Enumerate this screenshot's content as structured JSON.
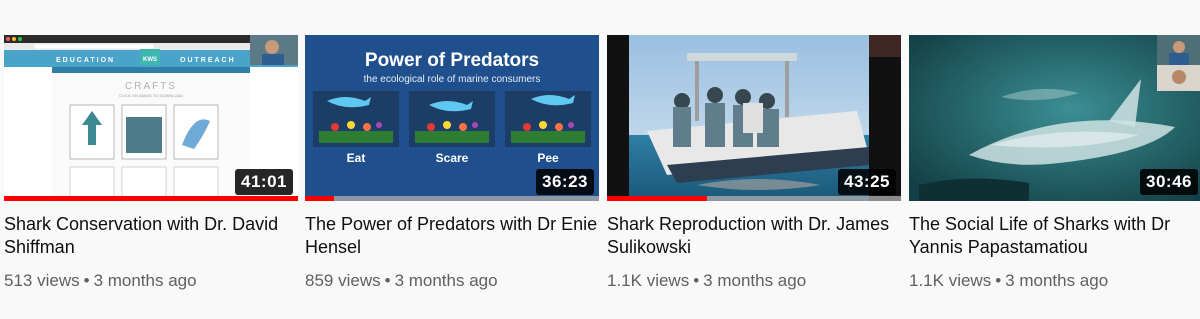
{
  "videos": [
    {
      "title": "Shark Conservation with Dr. David Shiffman",
      "views": "513 views",
      "age": "3 months ago",
      "duration": "41:01",
      "progress": 1.0,
      "thumb_text": {
        "banner": "EDUCATION",
        "banner2": "OUTREACH",
        "logo": "KWS",
        "heading": "CRAFTS",
        "subheading": "CLICK ON IMAGE TO DOWNLOAD"
      }
    },
    {
      "title": "The Power of Predators with Dr Enie Hensel",
      "views": "859 views",
      "age": "3 months ago",
      "duration": "36:23",
      "progress": 0.1,
      "thumb_text": {
        "heading": "Power of Predators",
        "subheading": "the ecological role of marine consumers",
        "panels": [
          "Eat",
          "Scare",
          "Pee"
        ]
      }
    },
    {
      "title": "Shark Reproduction with Dr. James Sulikowski",
      "views": "1.1K views",
      "age": "3 months ago",
      "duration": "43:25",
      "progress": 0.34
    },
    {
      "title": "The Social Life of Sharks with Dr Yannis Papastamatiou",
      "views": "1.1K views",
      "age": "3 months ago",
      "duration": "30:46",
      "progress": 0
    }
  ],
  "colors": {
    "progress": "#ff0000",
    "slide_blue": "#1f4f8c",
    "ocean": "#1e6a73"
  },
  "icons": {
    "meta_separator": "•"
  }
}
